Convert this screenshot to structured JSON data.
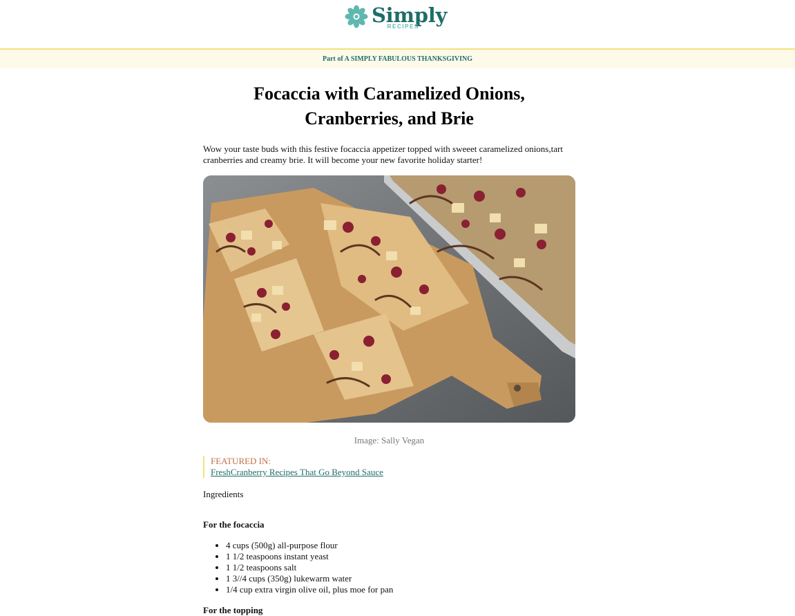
{
  "brand": {
    "name": "Simply",
    "sub": "RECIPES",
    "color_primary": "#1f6e68",
    "color_accent": "#5fb8b0"
  },
  "promo": {
    "text": "Part of A SIMPLY FABULOUS THANKSGIVING",
    "background": "#fdfae9"
  },
  "article": {
    "title": "Focaccia with Caramelized Onions, Cranberries, and Brie",
    "intro": "Wow your taste buds with this festive focaccia appetizer topped with sweeet caramelized onions,tart cranberries and creamy brie. It will become your new favorite holiday starter!",
    "hero_icon": "focaccia-photo",
    "caption": "Image: Sally Vegan",
    "featured": {
      "label": "FEATURED IN:",
      "link": "FreshCranberry Recipes That Go Beyond Sauce"
    },
    "ingredients_heading": "Ingredients",
    "sections": [
      {
        "heading": "For the focaccia",
        "items": [
          "4 cups (500g) all-purpose flour",
          "1 1/2 teaspoons instant yeast",
          "1 1/2 teaspoons salt",
          "1 3//4 cups (350g) lukewarm water",
          "1/4 cup extra virgin olive oil, plus moe for pan"
        ]
      },
      {
        "heading": "For the topping",
        "items": []
      }
    ]
  }
}
